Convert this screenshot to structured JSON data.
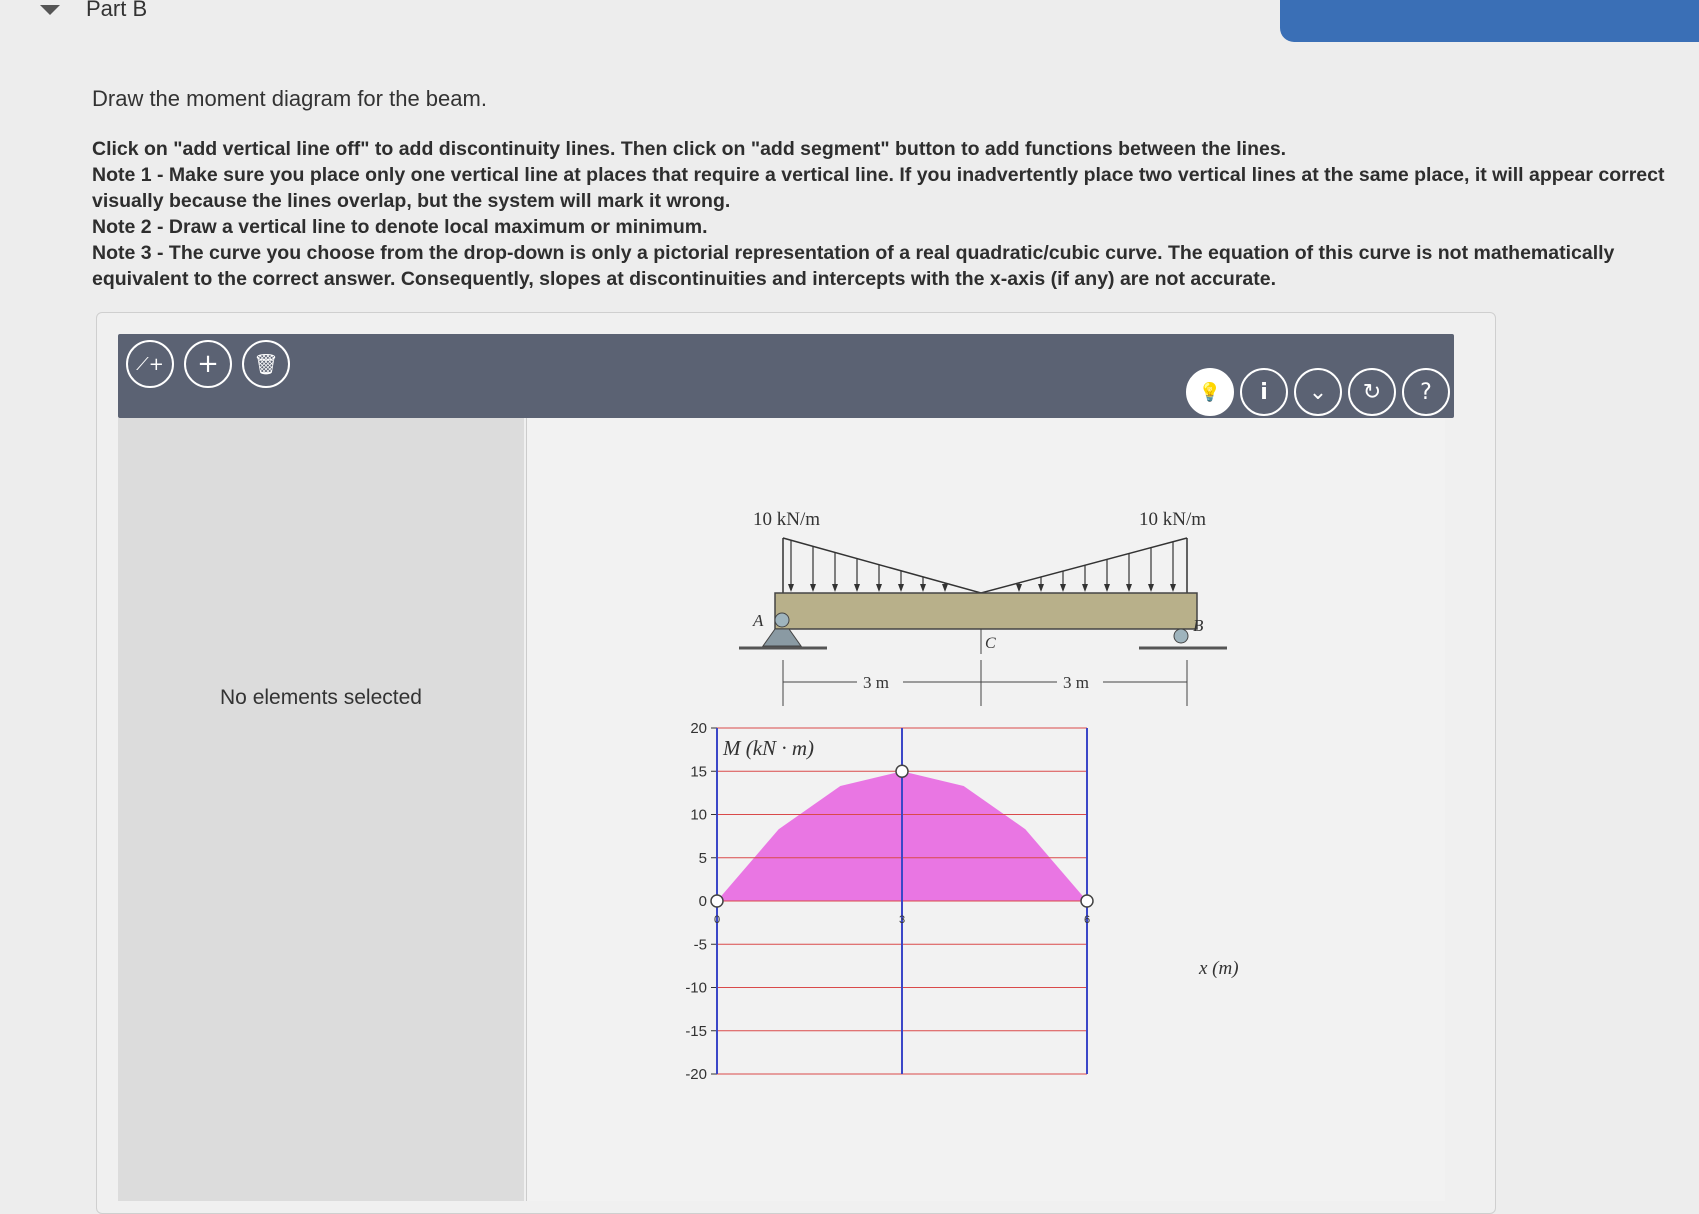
{
  "header": {
    "part_title": "Part B"
  },
  "instructions": {
    "lead": "Draw the moment diagram for the beam.",
    "lines": [
      "Click on \"add vertical line off\" to add discontinuity lines. Then click on \"add segment\" button to add functions between the lines.",
      "Note 1 - Make sure you place only one vertical line at places that require a vertical line. If you inadvertently place two vertical lines at the same place, it will appear correct visually because the lines overlap, but the system will mark it wrong.",
      "Note 2 - Draw a vertical line to denote local maximum or minimum.",
      "Note 3 - The curve you choose from the drop-down is only a pictorial representation of a real quadratic/cubic curve. The equation of this curve is not mathematically equivalent to the correct answer. Consequently, slopes at discontinuities and intercepts with the x-axis (if any) are not accurate."
    ]
  },
  "toolbar": {
    "left_buttons": [
      {
        "name": "add-vertical-line-button",
        "glyph": "⟋+"
      },
      {
        "name": "add-segment-button",
        "glyph": "+"
      },
      {
        "name": "delete-button",
        "glyph": "🗑"
      }
    ],
    "right_buttons": [
      {
        "name": "hint-button",
        "glyph": "💡"
      },
      {
        "name": "info-button",
        "glyph": "i"
      },
      {
        "name": "dropdown-button",
        "glyph": "⌄"
      },
      {
        "name": "reset-button",
        "glyph": "↻"
      },
      {
        "name": "help-button",
        "glyph": "?"
      }
    ]
  },
  "left_panel": {
    "status": "No elements selected"
  },
  "beam_figure": {
    "load_left": "10 kN/m",
    "load_right": "10 kN/m",
    "label_a": "A",
    "label_b": "B",
    "label_c": "C",
    "span_left": "3 m",
    "span_right": "3 m"
  },
  "chart_data": {
    "type": "area",
    "ylabel": "M (kN · m)",
    "xlabel": "x (m)",
    "ylim": [
      -20,
      20
    ],
    "yticks": [
      20,
      15,
      10,
      5,
      0,
      -5,
      -10,
      -15,
      -20
    ],
    "xticks": [
      0,
      3,
      6
    ],
    "vertical_lines_x": [
      0,
      3,
      6
    ],
    "curve": {
      "x": [
        0,
        1,
        2,
        3,
        4,
        5,
        6
      ],
      "y": [
        0,
        8.3,
        13.3,
        15,
        13.3,
        8.3,
        0
      ]
    },
    "points": [
      {
        "x": 0,
        "y": 0
      },
      {
        "x": 3,
        "y": 15
      },
      {
        "x": 6,
        "y": 0
      }
    ],
    "fill_color": "#e860e0",
    "gridline_color": "#d94a4a",
    "vertical_line_color": "#3b47c8"
  }
}
